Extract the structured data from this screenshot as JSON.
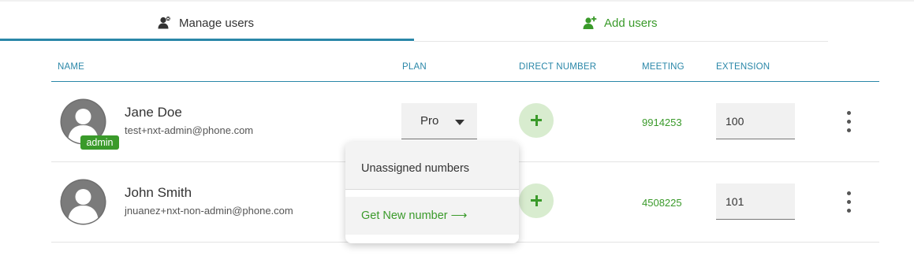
{
  "tabs": {
    "manage": "Manage users",
    "add": "Add users"
  },
  "columns": {
    "name": "NAME",
    "plan": "PLAN",
    "direct": "DIRECT NUMBER",
    "meeting": "MEETING",
    "extension": "EXTENSION"
  },
  "users": [
    {
      "name": "Jane Doe",
      "email": "test+nxt-admin@phone.com",
      "badge": "admin",
      "plan": "Pro",
      "meeting": "9914253",
      "extension": "100"
    },
    {
      "name": "John Smith",
      "email": "jnuanez+nxt-non-admin@phone.com",
      "meeting": "4508225",
      "extension": "101"
    }
  ],
  "dropdown": {
    "unassigned": "Unassigned numbers",
    "get_new": "Get New number ⟶"
  },
  "colors": {
    "accent": "#2a87a8",
    "green": "#3a9a2a"
  },
  "icons": {
    "manage": "users-manage-icon",
    "add": "add-user-icon",
    "plus": "plus-icon",
    "caret": "caret-down-icon",
    "more": "more-vertical-icon"
  }
}
